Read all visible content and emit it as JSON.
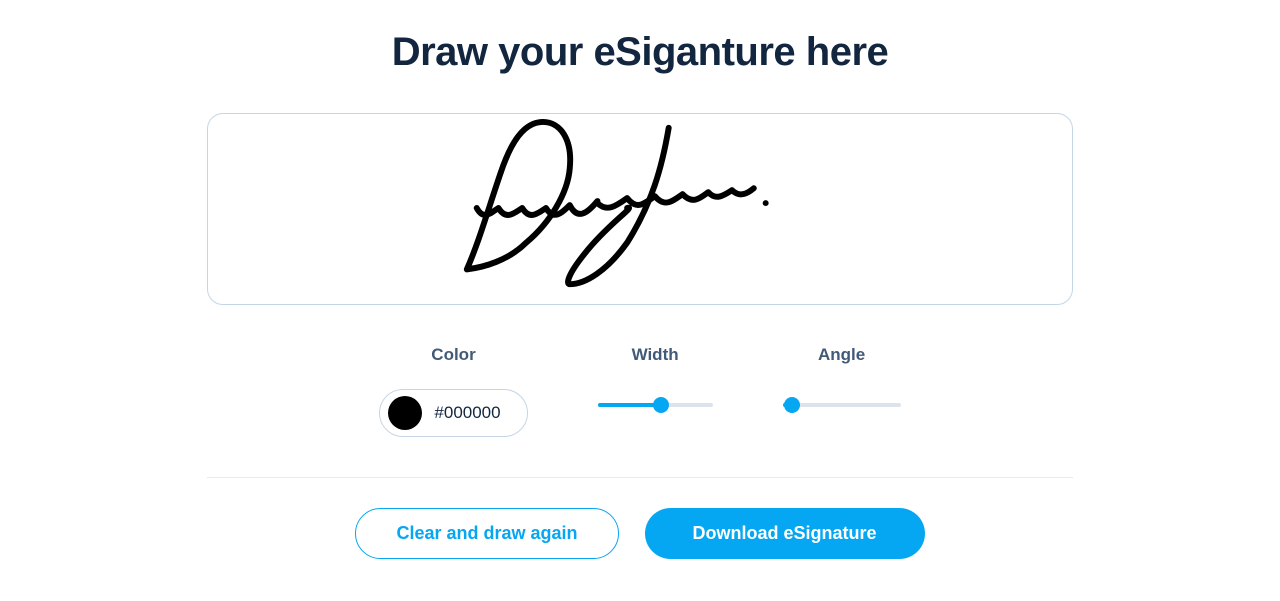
{
  "title": "Draw your eSiganture here",
  "signature": {
    "color": "#000000"
  },
  "controls": {
    "color": {
      "label": "Color",
      "value": "#000000"
    },
    "width": {
      "label": "Width",
      "percent": 55
    },
    "angle": {
      "label": "Angle",
      "percent": 8
    }
  },
  "buttons": {
    "clear": "Clear and draw again",
    "download": "Download eSignature"
  }
}
